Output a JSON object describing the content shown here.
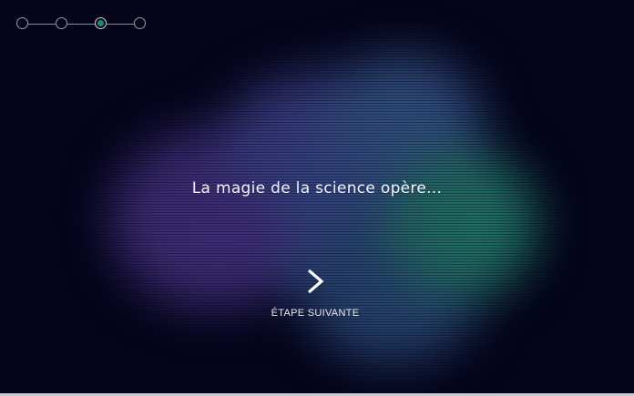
{
  "stepper": {
    "total_steps": 4,
    "current_step": 3,
    "colors": {
      "inactive_ring": "#9a9aa8",
      "active_fill": "#1f8a6e"
    }
  },
  "headline": "La magie de la science opère...",
  "next": {
    "icon": "chevron-right-icon",
    "label": "ÉTAPE SUIVANTE"
  },
  "colors": {
    "background": "#04041a",
    "cloud_purple": "#3a2a6e",
    "cloud_blue": "#31427a",
    "cloud_teal": "#22625f",
    "text": "#f2f2f7"
  }
}
